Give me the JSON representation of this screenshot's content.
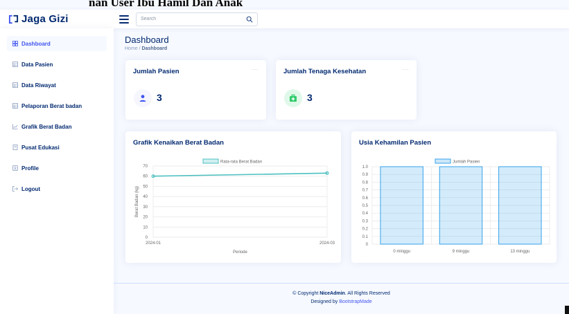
{
  "cap_text": "nan User Ibu Hamil Dan Anak",
  "header": {
    "app_name": "Jaga Gizi",
    "search_placeholder": "Search"
  },
  "sidebar": {
    "items": [
      {
        "label": "Dashboard",
        "icon": "grid-icon",
        "active": true
      },
      {
        "label": "Data Pasien",
        "icon": "table-icon",
        "active": false
      },
      {
        "label": "Data Riwayat",
        "icon": "table-icon",
        "active": false
      },
      {
        "label": "Pelaporan Berat badan",
        "icon": "table-icon",
        "active": false
      },
      {
        "label": "Grafik Berat Badan",
        "icon": "chart-icon",
        "active": false
      },
      {
        "label": "Pusat Edukasi",
        "icon": "book-icon",
        "active": false
      },
      {
        "label": "Profile",
        "icon": "person-icon",
        "active": false
      },
      {
        "label": "Logout",
        "icon": "logout-icon",
        "active": false
      }
    ]
  },
  "pagetitle": {
    "title": "Dashboard",
    "breadcrumb_home": "Home",
    "breadcrumb_sep": "/",
    "breadcrumb_current": "Dashboard"
  },
  "cards": {
    "patients": {
      "title": "Jumlah Pasien",
      "value": "3",
      "menu": "···",
      "icon": "person-icon",
      "color": "#4154f1",
      "bg": "#f6f6fe"
    },
    "health_workers": {
      "title": "Jumlah Tenaga Kesehatan",
      "value": "3",
      "menu": "···",
      "icon": "medical-kit-icon",
      "color": "#2eca6a",
      "bg": "#e0f8e9"
    }
  },
  "chart_data": [
    {
      "type": "line",
      "title": "Grafik Kenaikan Berat Badan",
      "xlabel": "Periode",
      "ylabel": "Berat Badan (kg)",
      "categories": [
        "2024-01",
        "2024-03"
      ],
      "series": [
        {
          "name": "Rata-rata Berat Badan",
          "values": [
            60,
            63
          ],
          "color": "#4bc0c0"
        }
      ],
      "ylim": [
        0,
        70
      ],
      "yticks": [
        0,
        10,
        20,
        30,
        40,
        50,
        60,
        70
      ],
      "grid": true,
      "legend": "top"
    },
    {
      "type": "bar",
      "title": "Usia Kehamilan Pasien",
      "xlabel": "",
      "ylabel": "",
      "categories": [
        "0 minggu",
        "9 minggu",
        "13 minggu"
      ],
      "series": [
        {
          "name": "Jumlah Pasien",
          "values": [
            1,
            1,
            1
          ],
          "color": "#36a2eb"
        }
      ],
      "ylim": [
        0,
        1.0
      ],
      "yticks": [
        "0",
        "0.1",
        "0.2",
        "0.3",
        "0.4",
        "0.5",
        "0.6",
        "0.7",
        "0.8",
        "0.9",
        "1.0"
      ],
      "grid": true,
      "legend": "top"
    }
  ],
  "footer": {
    "copyright_prefix": "© Copyright",
    "brand": "NiceAdmin",
    "rights": ". All Rights Reserved",
    "designed_by": "Designed by",
    "designer": "BootstrapMade"
  },
  "colors": {
    "primary": "#012970",
    "accent": "#4154f1",
    "bg": "#f6f9ff"
  }
}
